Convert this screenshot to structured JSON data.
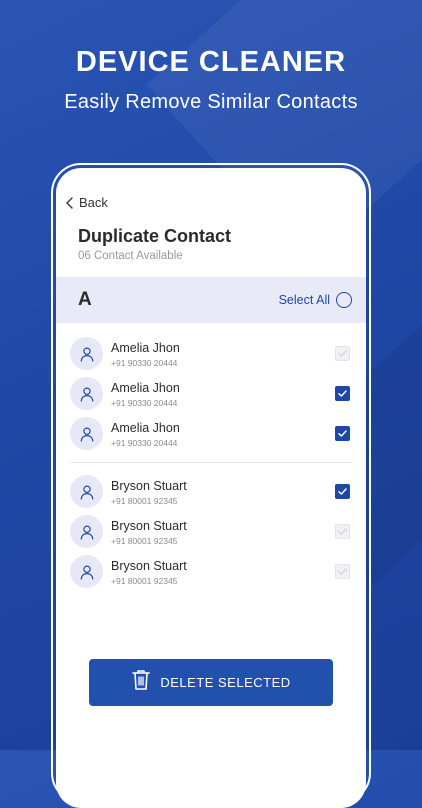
{
  "banner": {
    "headline": "DEVICE CLEANER",
    "subhead": "Easily Remove Similar Contacts"
  },
  "nav": {
    "back_label": "Back"
  },
  "page": {
    "title": "Duplicate Contact",
    "subtitle": "06 Contact Available"
  },
  "group": {
    "letter": "A",
    "select_all_label": "Select All",
    "select_all_checked": false
  },
  "contacts_group_1": [
    {
      "name": "Amelia Jhon",
      "phone": "+91 90330 20444",
      "state": "disabled"
    },
    {
      "name": "Amelia Jhon",
      "phone": "+91 90330 20444",
      "state": "checked"
    },
    {
      "name": "Amelia Jhon",
      "phone": "+91 90330 20444",
      "state": "checked"
    }
  ],
  "contacts_group_2": [
    {
      "name": "Bryson Stuart",
      "phone": "+91 80001 92345",
      "state": "checked"
    },
    {
      "name": "Bryson Stuart",
      "phone": "+91 80001 92345",
      "state": "disabled"
    },
    {
      "name": "Bryson Stuart",
      "phone": "+91 80001 92345",
      "state": "disabled"
    }
  ],
  "actions": {
    "delete_label": "DELETE SELECTED"
  },
  "icons": {
    "back": "chevron-left-icon",
    "avatar": "user-icon",
    "check": "checkmark-icon",
    "delete": "trash-icon"
  },
  "colors": {
    "accent": "#1f47a6",
    "background": "#1f48a6",
    "group_header_bg": "#e8eaf8",
    "avatar_bg": "#e6e8f5"
  }
}
